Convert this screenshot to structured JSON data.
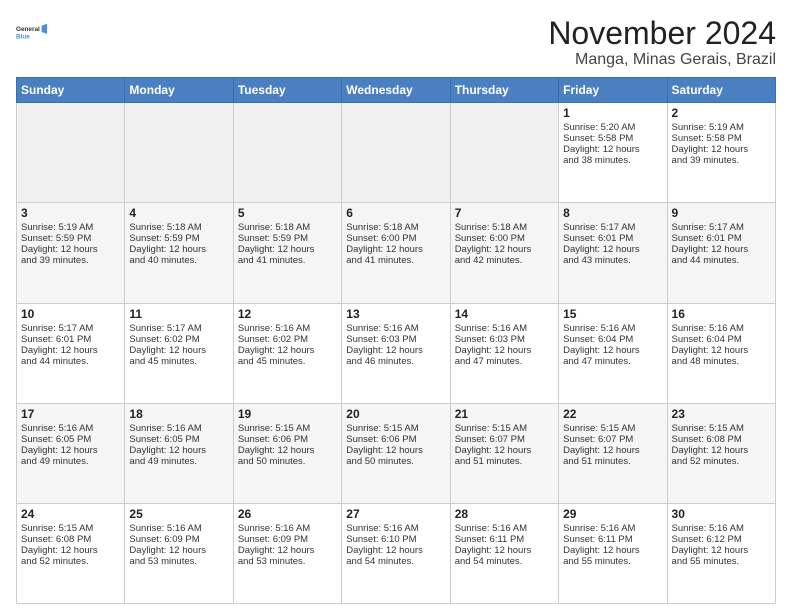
{
  "logo": {
    "line1": "General",
    "line2": "Blue"
  },
  "title": "November 2024",
  "location": "Manga, Minas Gerais, Brazil",
  "days_of_week": [
    "Sunday",
    "Monday",
    "Tuesday",
    "Wednesday",
    "Thursday",
    "Friday",
    "Saturday"
  ],
  "weeks": [
    [
      {
        "day": "",
        "empty": true
      },
      {
        "day": "",
        "empty": true
      },
      {
        "day": "",
        "empty": true
      },
      {
        "day": "",
        "empty": true
      },
      {
        "day": "",
        "empty": true
      },
      {
        "day": "1",
        "lines": [
          "Sunrise: 5:20 AM",
          "Sunset: 5:58 PM",
          "Daylight: 12 hours",
          "and 38 minutes."
        ]
      },
      {
        "day": "2",
        "lines": [
          "Sunrise: 5:19 AM",
          "Sunset: 5:58 PM",
          "Daylight: 12 hours",
          "and 39 minutes."
        ]
      }
    ],
    [
      {
        "day": "3",
        "lines": [
          "Sunrise: 5:19 AM",
          "Sunset: 5:59 PM",
          "Daylight: 12 hours",
          "and 39 minutes."
        ]
      },
      {
        "day": "4",
        "lines": [
          "Sunrise: 5:18 AM",
          "Sunset: 5:59 PM",
          "Daylight: 12 hours",
          "and 40 minutes."
        ]
      },
      {
        "day": "5",
        "lines": [
          "Sunrise: 5:18 AM",
          "Sunset: 5:59 PM",
          "Daylight: 12 hours",
          "and 41 minutes."
        ]
      },
      {
        "day": "6",
        "lines": [
          "Sunrise: 5:18 AM",
          "Sunset: 6:00 PM",
          "Daylight: 12 hours",
          "and 41 minutes."
        ]
      },
      {
        "day": "7",
        "lines": [
          "Sunrise: 5:18 AM",
          "Sunset: 6:00 PM",
          "Daylight: 12 hours",
          "and 42 minutes."
        ]
      },
      {
        "day": "8",
        "lines": [
          "Sunrise: 5:17 AM",
          "Sunset: 6:01 PM",
          "Daylight: 12 hours",
          "and 43 minutes."
        ]
      },
      {
        "day": "9",
        "lines": [
          "Sunrise: 5:17 AM",
          "Sunset: 6:01 PM",
          "Daylight: 12 hours",
          "and 44 minutes."
        ]
      }
    ],
    [
      {
        "day": "10",
        "lines": [
          "Sunrise: 5:17 AM",
          "Sunset: 6:01 PM",
          "Daylight: 12 hours",
          "and 44 minutes."
        ]
      },
      {
        "day": "11",
        "lines": [
          "Sunrise: 5:17 AM",
          "Sunset: 6:02 PM",
          "Daylight: 12 hours",
          "and 45 minutes."
        ]
      },
      {
        "day": "12",
        "lines": [
          "Sunrise: 5:16 AM",
          "Sunset: 6:02 PM",
          "Daylight: 12 hours",
          "and 45 minutes."
        ]
      },
      {
        "day": "13",
        "lines": [
          "Sunrise: 5:16 AM",
          "Sunset: 6:03 PM",
          "Daylight: 12 hours",
          "and 46 minutes."
        ]
      },
      {
        "day": "14",
        "lines": [
          "Sunrise: 5:16 AM",
          "Sunset: 6:03 PM",
          "Daylight: 12 hours",
          "and 47 minutes."
        ]
      },
      {
        "day": "15",
        "lines": [
          "Sunrise: 5:16 AM",
          "Sunset: 6:04 PM",
          "Daylight: 12 hours",
          "and 47 minutes."
        ]
      },
      {
        "day": "16",
        "lines": [
          "Sunrise: 5:16 AM",
          "Sunset: 6:04 PM",
          "Daylight: 12 hours",
          "and 48 minutes."
        ]
      }
    ],
    [
      {
        "day": "17",
        "lines": [
          "Sunrise: 5:16 AM",
          "Sunset: 6:05 PM",
          "Daylight: 12 hours",
          "and 49 minutes."
        ]
      },
      {
        "day": "18",
        "lines": [
          "Sunrise: 5:16 AM",
          "Sunset: 6:05 PM",
          "Daylight: 12 hours",
          "and 49 minutes."
        ]
      },
      {
        "day": "19",
        "lines": [
          "Sunrise: 5:15 AM",
          "Sunset: 6:06 PM",
          "Daylight: 12 hours",
          "and 50 minutes."
        ]
      },
      {
        "day": "20",
        "lines": [
          "Sunrise: 5:15 AM",
          "Sunset: 6:06 PM",
          "Daylight: 12 hours",
          "and 50 minutes."
        ]
      },
      {
        "day": "21",
        "lines": [
          "Sunrise: 5:15 AM",
          "Sunset: 6:07 PM",
          "Daylight: 12 hours",
          "and 51 minutes."
        ]
      },
      {
        "day": "22",
        "lines": [
          "Sunrise: 5:15 AM",
          "Sunset: 6:07 PM",
          "Daylight: 12 hours",
          "and 51 minutes."
        ]
      },
      {
        "day": "23",
        "lines": [
          "Sunrise: 5:15 AM",
          "Sunset: 6:08 PM",
          "Daylight: 12 hours",
          "and 52 minutes."
        ]
      }
    ],
    [
      {
        "day": "24",
        "lines": [
          "Sunrise: 5:15 AM",
          "Sunset: 6:08 PM",
          "Daylight: 12 hours",
          "and 52 minutes."
        ]
      },
      {
        "day": "25",
        "lines": [
          "Sunrise: 5:16 AM",
          "Sunset: 6:09 PM",
          "Daylight: 12 hours",
          "and 53 minutes."
        ]
      },
      {
        "day": "26",
        "lines": [
          "Sunrise: 5:16 AM",
          "Sunset: 6:09 PM",
          "Daylight: 12 hours",
          "and 53 minutes."
        ]
      },
      {
        "day": "27",
        "lines": [
          "Sunrise: 5:16 AM",
          "Sunset: 6:10 PM",
          "Daylight: 12 hours",
          "and 54 minutes."
        ]
      },
      {
        "day": "28",
        "lines": [
          "Sunrise: 5:16 AM",
          "Sunset: 6:11 PM",
          "Daylight: 12 hours",
          "and 54 minutes."
        ]
      },
      {
        "day": "29",
        "lines": [
          "Sunrise: 5:16 AM",
          "Sunset: 6:11 PM",
          "Daylight: 12 hours",
          "and 55 minutes."
        ]
      },
      {
        "day": "30",
        "lines": [
          "Sunrise: 5:16 AM",
          "Sunset: 6:12 PM",
          "Daylight: 12 hours",
          "and 55 minutes."
        ]
      }
    ]
  ]
}
